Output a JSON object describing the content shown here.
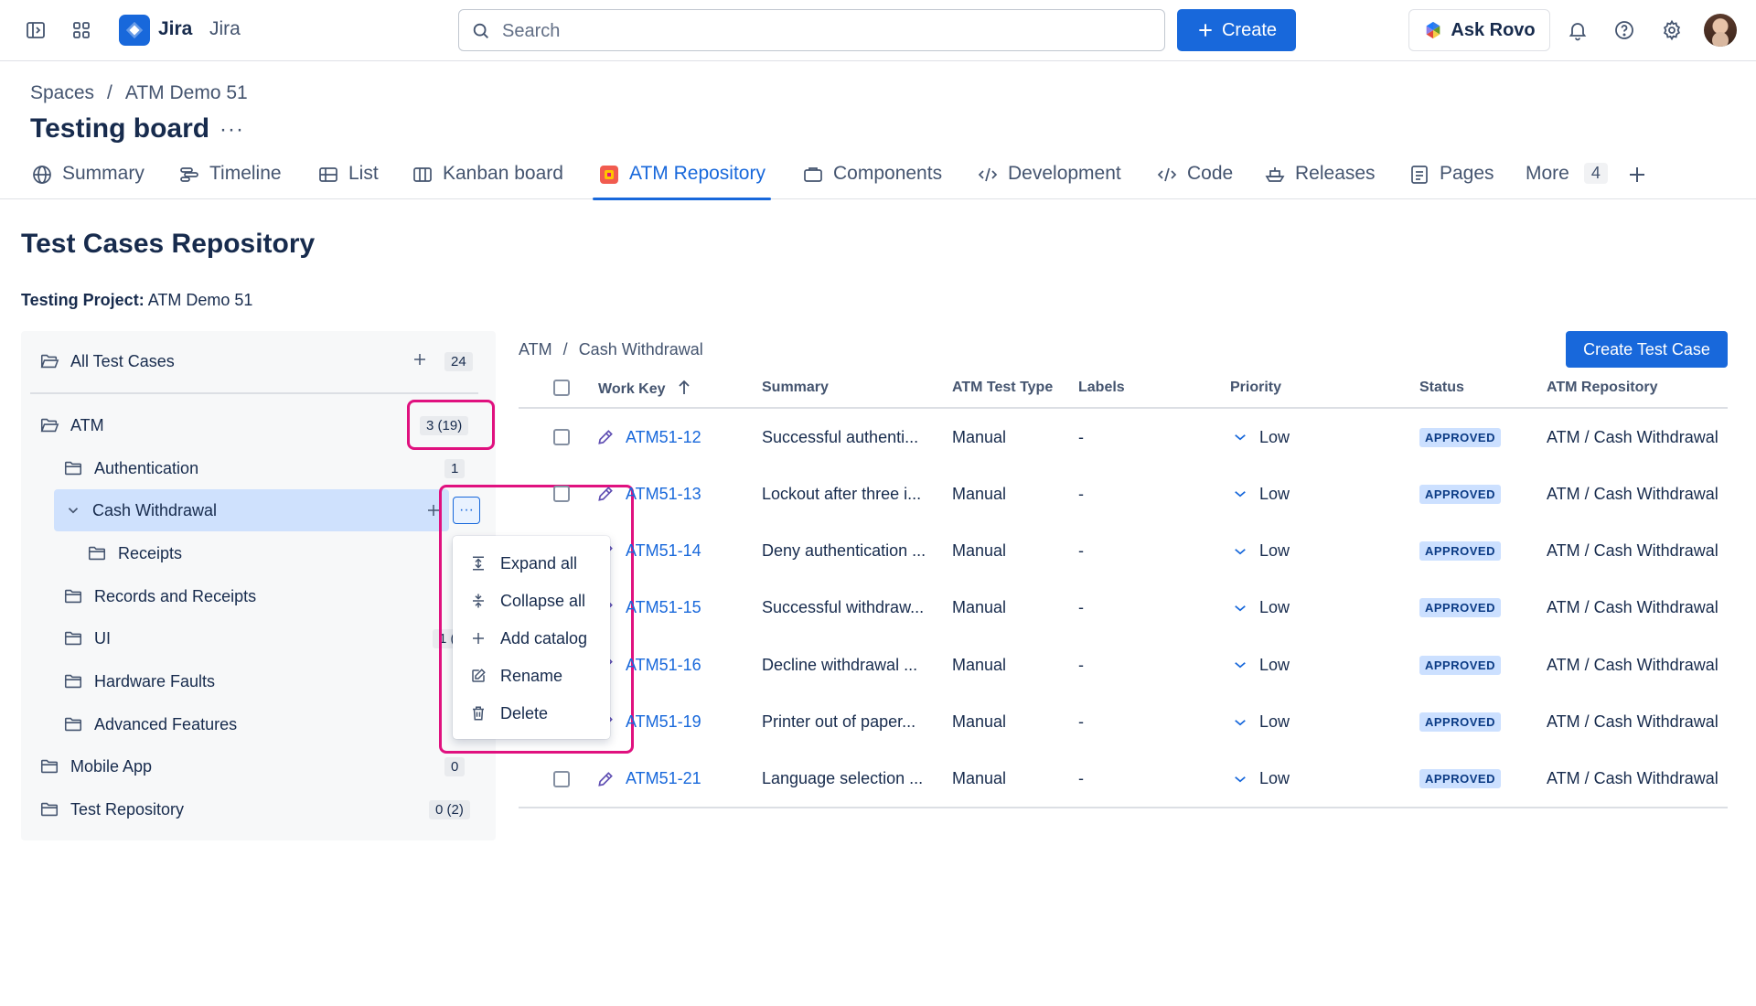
{
  "topbar": {
    "brand_bold": "Jira",
    "brand_name": "Jira",
    "search_placeholder": "Search",
    "create_label": "Create",
    "ask_rovo_label": "Ask Rovo"
  },
  "breadcrumb": [
    "Spaces",
    "/",
    "ATM Demo 51"
  ],
  "page_title": "Testing board",
  "title_more": "···",
  "tabs": [
    {
      "label": "Summary",
      "icon": "globe-icon"
    },
    {
      "label": "Timeline",
      "icon": "timeline-icon"
    },
    {
      "label": "List",
      "icon": "list-icon"
    },
    {
      "label": "Kanban board",
      "icon": "board-icon"
    },
    {
      "label": "ATM Repository",
      "icon": "app-icon",
      "active": true
    },
    {
      "label": "Components",
      "icon": "component-icon"
    },
    {
      "label": "Development",
      "icon": "development-icon"
    },
    {
      "label": "Code",
      "icon": "code-icon"
    },
    {
      "label": "Releases",
      "icon": "ship-icon"
    },
    {
      "label": "Pages",
      "icon": "page-icon"
    },
    {
      "label": "More",
      "icon": "",
      "count": "4"
    }
  ],
  "repo": {
    "title": "Test Cases Repository",
    "project_label": "Testing Project:",
    "project_value": "ATM Demo 51"
  },
  "tree": {
    "root": {
      "label": "All Test Cases",
      "count": "24"
    },
    "nodes": [
      {
        "label": "ATM",
        "count": "3 (19)"
      },
      {
        "label": "Authentication",
        "count": "1"
      },
      {
        "label": "Cash Withdrawal"
      },
      {
        "label": "Receipts"
      },
      {
        "label": "Records and Receipts"
      },
      {
        "label": "UI",
        "count": "1 ("
      },
      {
        "label": "Hardware Faults"
      },
      {
        "label": "Advanced Features"
      },
      {
        "label": "Mobile App",
        "count": "0"
      },
      {
        "label": "Test Repository",
        "count": "0 (2)"
      }
    ],
    "dots_label": "···"
  },
  "context_menu": [
    {
      "label": "Expand all",
      "icon": "expand-icon"
    },
    {
      "label": "Collapse all",
      "icon": "collapse-icon"
    },
    {
      "label": "Add catalog",
      "icon": "plus-icon"
    },
    {
      "label": "Rename",
      "icon": "edit-icon"
    },
    {
      "label": "Delete",
      "icon": "trash-icon"
    }
  ],
  "table": {
    "breadcrumb": [
      "ATM",
      "/",
      "Cash Withdrawal"
    ],
    "create_button": "Create Test Case",
    "headers": [
      "Work Key",
      "Summary",
      "ATM Test Type",
      "Labels",
      "Priority",
      "Status",
      "ATM Repository"
    ],
    "rows": [
      {
        "key": "ATM51-12",
        "summary": "Successful authenti...",
        "type": "Manual",
        "labels": "-",
        "priority": "Low",
        "status": "APPROVED",
        "repo": "ATM / Cash Withdrawal"
      },
      {
        "key": "ATM51-13",
        "summary": "Lockout after three i...",
        "type": "Manual",
        "labels": "-",
        "priority": "Low",
        "status": "APPROVED",
        "repo": "ATM / Cash Withdrawal"
      },
      {
        "key": "ATM51-14",
        "summary": "Deny authentication ...",
        "type": "Manual",
        "labels": "-",
        "priority": "Low",
        "status": "APPROVED",
        "repo": "ATM / Cash Withdrawal"
      },
      {
        "key": "ATM51-15",
        "summary": "Successful withdraw...",
        "type": "Manual",
        "labels": "-",
        "priority": "Low",
        "status": "APPROVED",
        "repo": "ATM / Cash Withdrawal"
      },
      {
        "key": "ATM51-16",
        "summary": "Decline withdrawal ...",
        "type": "Manual",
        "labels": "-",
        "priority": "Low",
        "status": "APPROVED",
        "repo": "ATM / Cash Withdrawal"
      },
      {
        "key": "ATM51-19",
        "summary": "Printer out of paper...",
        "type": "Manual",
        "labels": "-",
        "priority": "Low",
        "status": "APPROVED",
        "repo": "ATM / Cash Withdrawal"
      },
      {
        "key": "ATM51-21",
        "summary": "Language selection ...",
        "type": "Manual",
        "labels": "-",
        "priority": "Low",
        "status": "APPROVED",
        "repo": "ATM / Cash Withdrawal"
      }
    ]
  },
  "colors": {
    "accent": "#1868db",
    "highlight": "#e0117f",
    "status_bg": "#cce0ff"
  }
}
